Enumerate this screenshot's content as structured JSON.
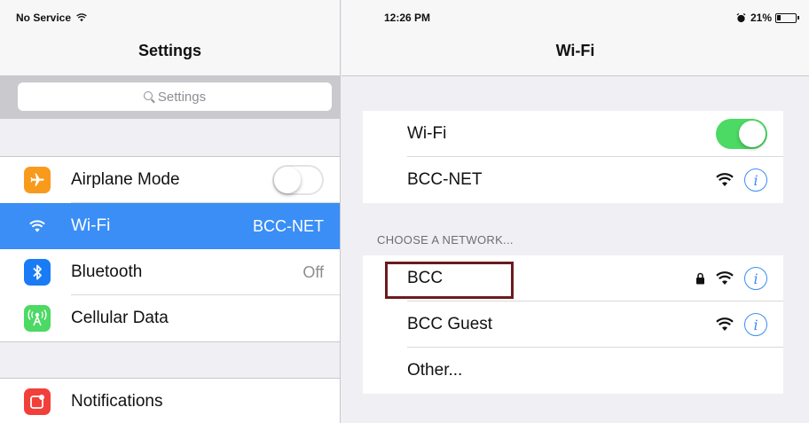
{
  "left": {
    "carrier": "No Service",
    "title": "Settings",
    "search_placeholder": "Settings",
    "items": [
      {
        "label": "Airplane Mode",
        "value": "",
        "icon": "airplane-icon",
        "color": "#f89a1c"
      },
      {
        "label": "Wi-Fi",
        "value": "BCC-NET",
        "icon": "wifi-icon",
        "color": "#3a8ef6",
        "selected": true
      },
      {
        "label": "Bluetooth",
        "value": "Off",
        "icon": "bluetooth-icon",
        "color": "#1a7cf5"
      },
      {
        "label": "Cellular Data",
        "value": "",
        "icon": "cellular-icon",
        "color": "#4cd964"
      },
      {
        "label": "Notifications",
        "value": "",
        "icon": "notifications-icon",
        "color": "#f23f3a"
      }
    ]
  },
  "right": {
    "time": "12:26 PM",
    "battery": "21%",
    "title": "Wi-Fi",
    "wifi_label": "Wi-Fi",
    "wifi_on": true,
    "connected_network": "BCC-NET",
    "section_header": "CHOOSE A NETWORK...",
    "networks": [
      {
        "name": "BCC",
        "locked": true
      },
      {
        "name": "BCC Guest",
        "locked": false
      },
      {
        "name": "Other...",
        "locked": false
      }
    ]
  },
  "colors": {
    "accent": "#3a8ef6",
    "toggle_on": "#4cd964",
    "highlight": "#6b1a1f"
  }
}
